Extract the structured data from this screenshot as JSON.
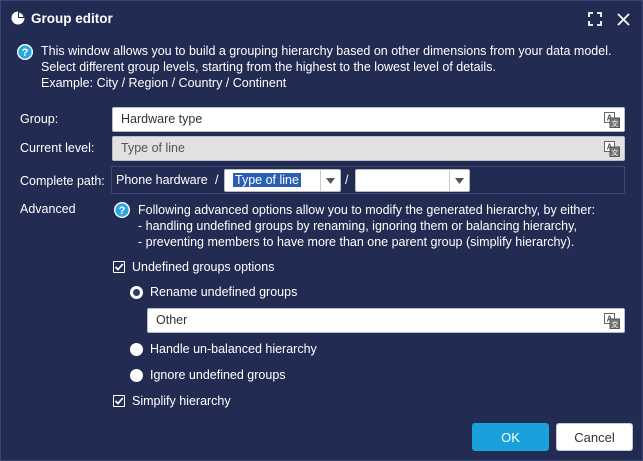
{
  "window": {
    "title": "Group editor",
    "icons": {
      "app": "pie-chart-icon",
      "maximize": "maximize-icon",
      "close": "close-icon"
    }
  },
  "intro": {
    "lines": [
      "This window allows you to build a grouping hierarchy based on other dimensions from your data model.",
      "Select different group levels, starting from the highest to the lowest level of details.",
      "Example: City / Region / Country / Continent"
    ]
  },
  "form": {
    "group_label": "Group:",
    "group_value": "Hardware type",
    "current_level_label": "Current level:",
    "current_level_value": "Type of line",
    "complete_path_label": "Complete path:",
    "path_root": "Phone hardware",
    "path_separator": "/",
    "level1_value": "Type of line",
    "level2_value": ""
  },
  "advanced": {
    "label": "Advanced",
    "info_lines": [
      "Following advanced options allow you to modify the generated hierarchy, by either:",
      "- handling undefined groups by renaming, ignoring them or balancing hierarchy,",
      "- preventing members to have more than one parent group (simplify hierarchy)."
    ],
    "undefined_groups_label": "Undefined groups options",
    "undefined_groups_checked": true,
    "rename_label": "Rename undefined groups",
    "rename_value": "Other",
    "unbalanced_label": "Handle un-balanced hierarchy",
    "ignore_label": "Ignore undefined groups",
    "selected_option": "rename",
    "simplify_label": "Simplify hierarchy",
    "simplify_checked": true
  },
  "buttons": {
    "ok": "OK",
    "cancel": "Cancel"
  },
  "colors": {
    "background": "#222c52",
    "accent": "#1aa0dd",
    "info": "#29a8e0"
  }
}
